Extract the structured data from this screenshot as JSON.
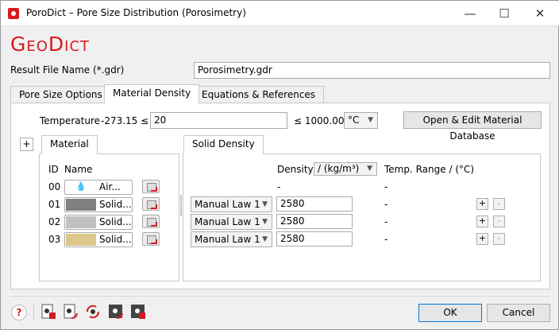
{
  "window": {
    "title": "PoroDict – Pore Size Distribution (Porosimetry)",
    "minimize": "—",
    "maximize": "☐",
    "close": "✕"
  },
  "logo": "GeoDict",
  "result_file": {
    "label": "Result File Name (*.gdr)",
    "value": "Porosimetry.gdr"
  },
  "tabs": [
    "Pore Size Options",
    "Material Density",
    "Equations & References"
  ],
  "temperature": {
    "label": "Temperature",
    "min": "-273.15 ≤",
    "value": "20",
    "max": "≤ 1000.00",
    "unit": "°C"
  },
  "open_db_button": "Open & Edit Material Database",
  "add_button": "+",
  "material_tab": "Material",
  "solid_density_tab": "Solid Density",
  "headers": {
    "id": "ID",
    "name": "Name",
    "density": "Density",
    "density_unit": "/ (kg/m³)",
    "temp_range": "Temp. Range / (°C)"
  },
  "materials": [
    {
      "id": "00",
      "name": "Air...",
      "color": "#ffffff",
      "law": "",
      "density": "-",
      "range": "-"
    },
    {
      "id": "01",
      "name": "Solid...",
      "color": "#808080",
      "law": "Manual Law 1",
      "density": "2580",
      "range": "-"
    },
    {
      "id": "02",
      "name": "Solid...",
      "color": "#c0c0c0",
      "law": "Manual Law 1",
      "density": "2580",
      "range": "-"
    },
    {
      "id": "03",
      "name": "Solid...",
      "color": "#dcc88c",
      "law": "Manual Law 1",
      "density": "2580",
      "range": "-"
    }
  ],
  "plus": "+",
  "minus": "-",
  "help": "?",
  "ok": "OK",
  "cancel": "Cancel"
}
